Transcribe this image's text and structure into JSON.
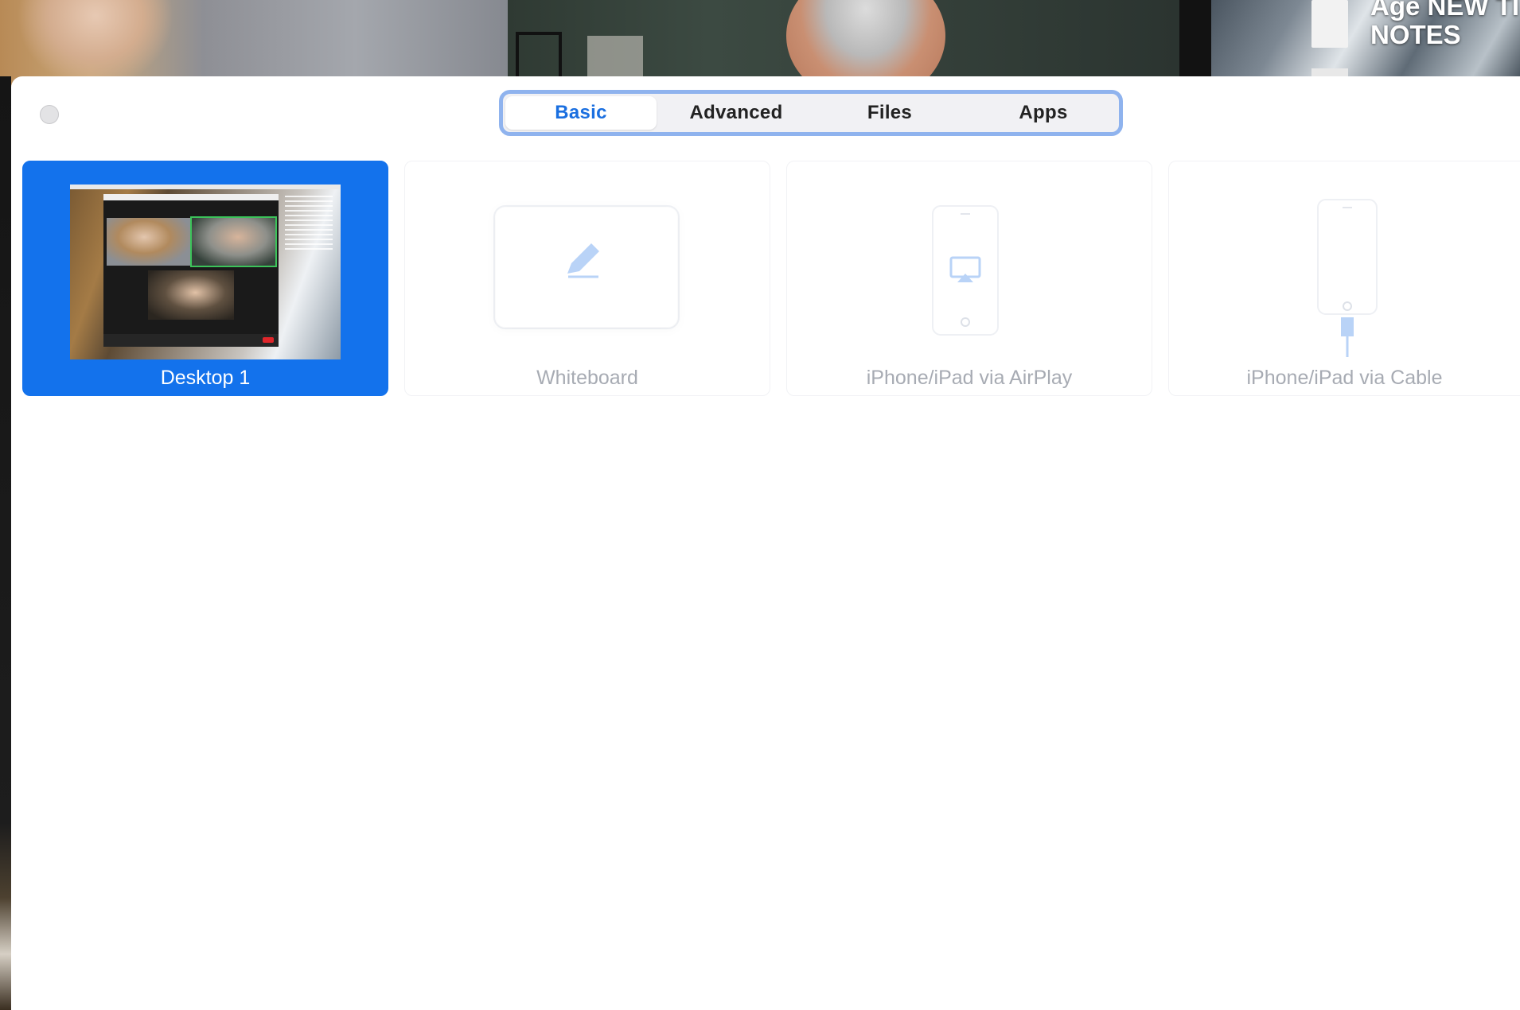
{
  "background": {
    "tile_overlay_text": "Age NEW TI\nNOTES"
  },
  "dialog": {
    "tabs": [
      {
        "label": "Basic",
        "active": true
      },
      {
        "label": "Advanced",
        "active": false
      },
      {
        "label": "Files",
        "active": false
      },
      {
        "label": "Apps",
        "active": false
      }
    ],
    "share_options": [
      {
        "label": "Desktop 1",
        "icon": "desktop-thumbnail",
        "selected": true
      },
      {
        "label": "Whiteboard",
        "icon": "pencil-icon",
        "selected": false
      },
      {
        "label": "iPhone/iPad via AirPlay",
        "icon": "airplay-icon",
        "selected": false
      },
      {
        "label": "iPhone/iPad via Cable",
        "icon": "cable-icon",
        "selected": false
      }
    ]
  },
  "colors": {
    "accent": "#1372ec",
    "tab_active_text": "#1a6fe0",
    "tab_border": "#8fb3ee",
    "disabled_text": "#a7abb3",
    "icon_tint": "#b9d3f7"
  }
}
